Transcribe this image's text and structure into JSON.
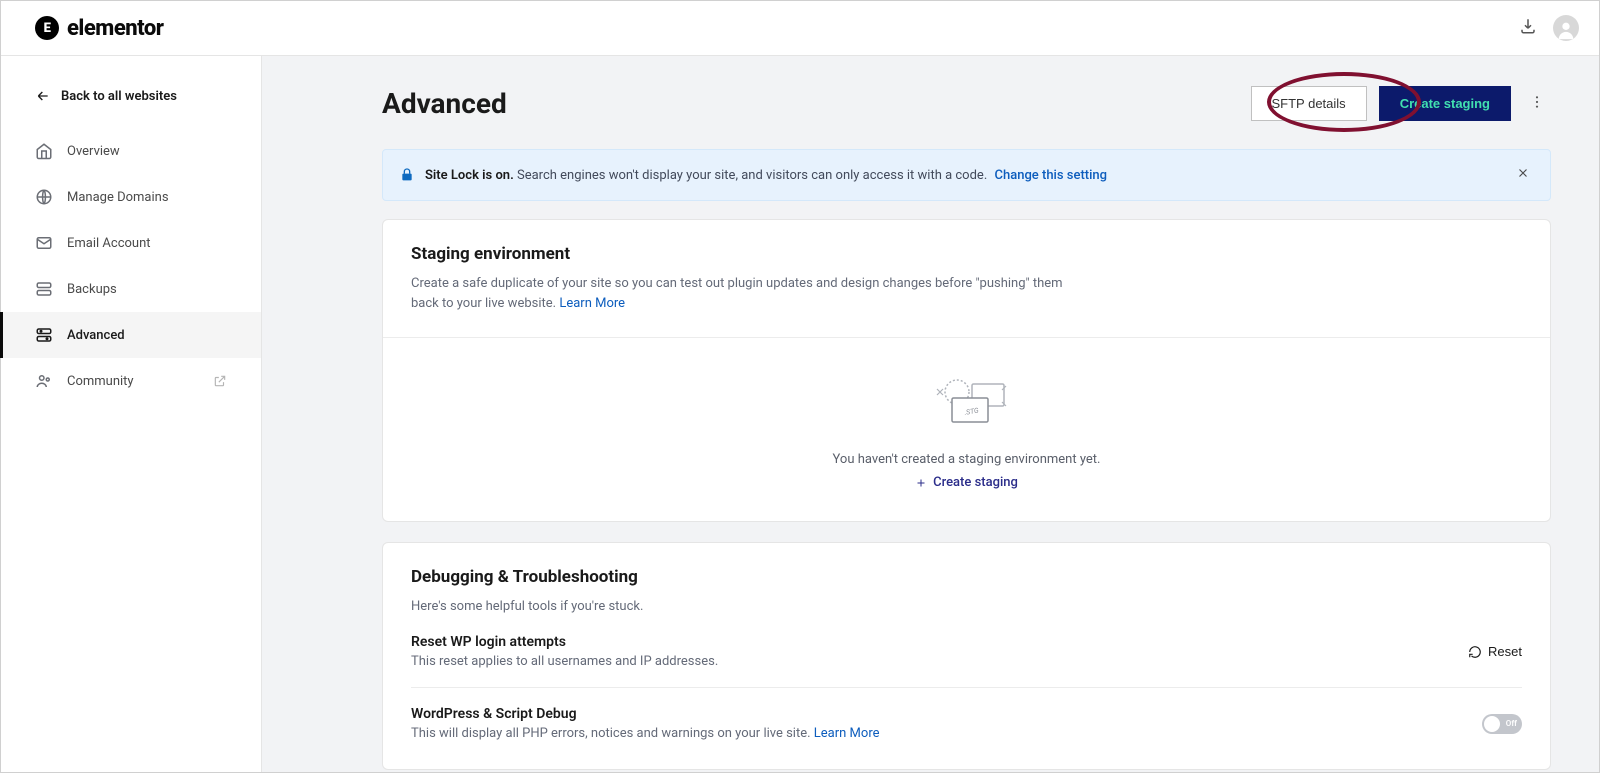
{
  "brand": "elementor",
  "sidebar": {
    "back_link": "Back to all websites",
    "items": [
      {
        "label": "Overview"
      },
      {
        "label": "Manage Domains"
      },
      {
        "label": "Email Account"
      },
      {
        "label": "Backups"
      },
      {
        "label": "Advanced"
      },
      {
        "label": "Community"
      }
    ]
  },
  "page": {
    "title": "Advanced",
    "actions": {
      "sftp": "SFTP details",
      "create_staging": "Create staging"
    }
  },
  "banner": {
    "prefix": "Site Lock is on.",
    "body": "Search engines won't display your site, and visitors can only access it with a code.",
    "link": "Change this setting"
  },
  "staging": {
    "title": "Staging environment",
    "desc": "Create a safe duplicate of your site so you can test out plugin updates and design changes before \"pushing\" them back to your live website.",
    "learn_more": "Learn More",
    "empty": "You haven't created a staging environment yet.",
    "create": "Create staging"
  },
  "debug": {
    "title": "Debugging & Troubleshooting",
    "sub": "Here's some helpful tools if you're stuck.",
    "reset": {
      "title": "Reset WP login attempts",
      "desc": "This reset applies to all usernames and IP addresses.",
      "btn": "Reset"
    },
    "wpdebug": {
      "title": "WordPress & Script Debug",
      "desc": "This will display all PHP errors, notices and warnings on your live site.",
      "learn_more": "Learn More",
      "toggle_state": "Off"
    }
  }
}
